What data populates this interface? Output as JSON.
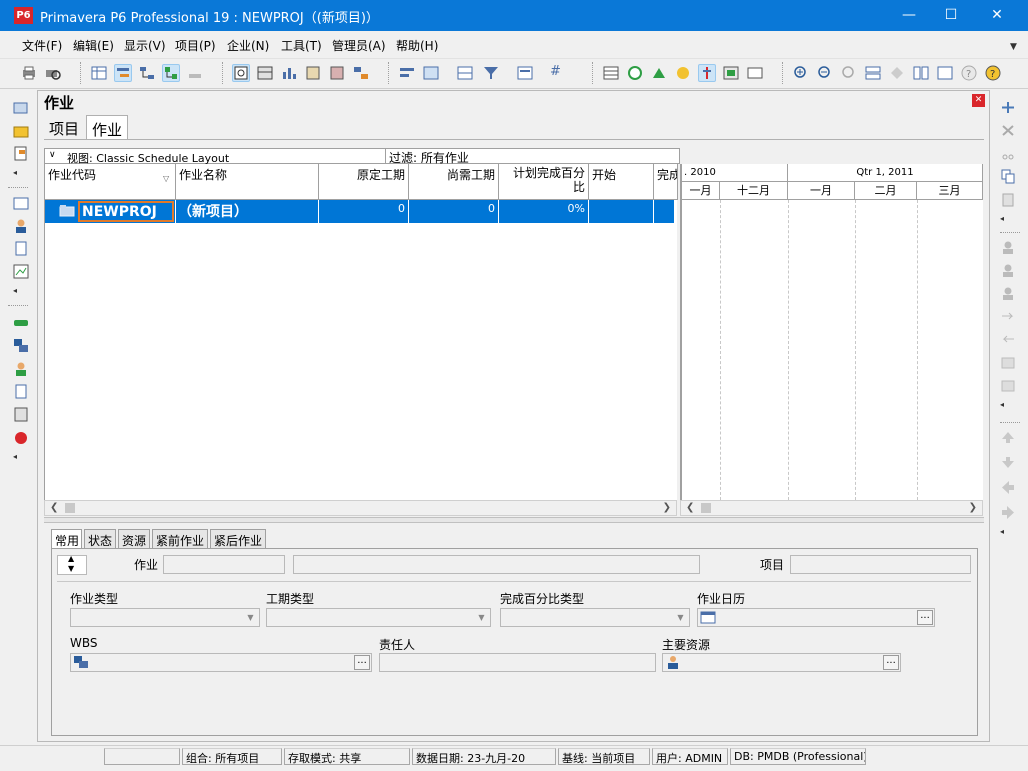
{
  "window": {
    "app_icon_text": "P6",
    "title": "Primavera P6 Professional 19 : NEWPROJ（(新项目)）",
    "minimize": "—",
    "maximize": "☐",
    "close": "✕"
  },
  "menubar": {
    "items": [
      "文件(F)",
      "编辑(E)",
      "显示(V)",
      "项目(P)",
      "企业(N)",
      "工具(T)",
      "管理员(A)",
      "帮助(H)"
    ]
  },
  "panel": {
    "title": "作业",
    "tabs": [
      "项目",
      "作业"
    ]
  },
  "grid": {
    "view_label": "视图: Classic Schedule Layout",
    "filter_label": "过滤: 所有作业",
    "columns": [
      "作业代码",
      "作业名称",
      "原定工期",
      "尚需工期",
      "计划完成百分比",
      "开始",
      "完成"
    ],
    "rows": [
      {
        "code": "NEWPROJ",
        "name": "（新项目）",
        "original_duration": "0",
        "remaining_duration": "0",
        "percent_complete": "0%",
        "start": "",
        "finish": ""
      }
    ]
  },
  "gantt": {
    "quarters": [
      ". 2010",
      "Qtr 1, 2011"
    ],
    "months": [
      "一月",
      "十二月",
      "一月",
      "二月",
      "三月"
    ]
  },
  "detail": {
    "tabs": [
      "常用",
      "状态",
      "资源",
      "紧前作业",
      "紧后作业"
    ],
    "activity_label": "作业",
    "project_label": "项目",
    "activity_type_label": "作业类型",
    "duration_type_label": "工期类型",
    "percent_type_label": "完成百分比类型",
    "calendar_label": "作业日历",
    "wbs_label": "WBS",
    "responsible_label": "责任人",
    "primary_resource_label": "主要资源"
  },
  "statusbar": {
    "portfolio": "组合: 所有项目",
    "access_mode": "存取模式: 共享",
    "data_date": "数据日期: 23-九月-20",
    "baseline": "基线: 当前项目",
    "user": "用户: ADMIN",
    "db": "DB: PMDB (Professional)"
  },
  "colors": {
    "titlebar": "#0a78d7",
    "selected_row": "#0076d6",
    "app_icon": "#d9262b"
  }
}
